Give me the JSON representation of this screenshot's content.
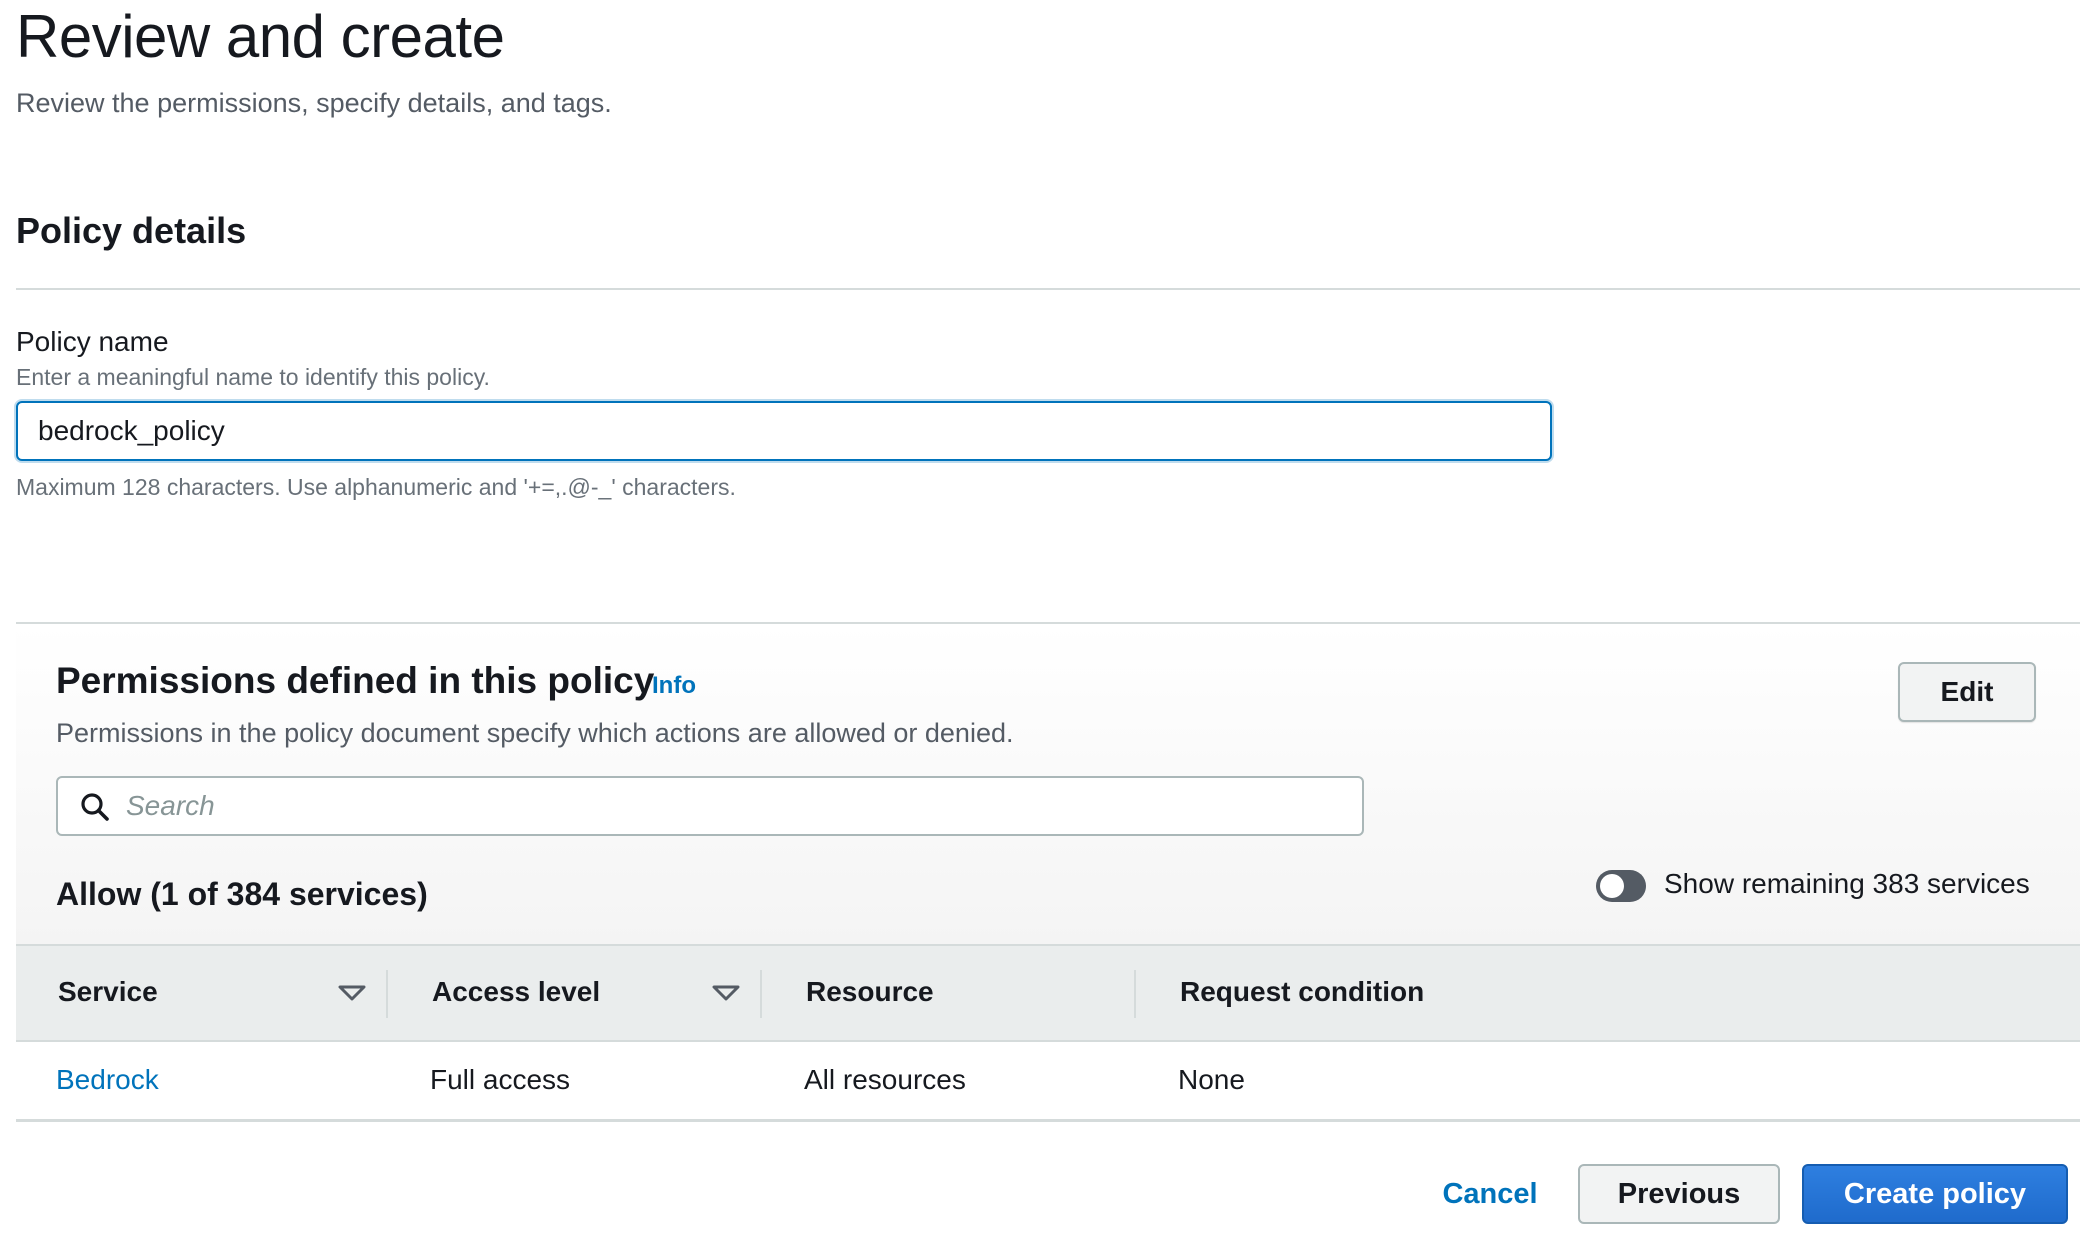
{
  "page": {
    "title": "Review and create",
    "subtitle": "Review the permissions, specify details, and tags."
  },
  "policy_details": {
    "section_title": "Policy details",
    "name_label": "Policy name",
    "name_description": "Enter a meaningful name to identify this policy.",
    "name_value": "bedrock_policy",
    "name_constraint": "Maximum 128 characters. Use alphanumeric and '+=,.@-_' characters."
  },
  "permissions": {
    "title": "Permissions defined in this policy",
    "info_link": "Info",
    "description": "Permissions in the policy document specify which actions are allowed or denied.",
    "edit_label": "Edit",
    "search_placeholder": "Search",
    "allow_title": "Allow (1 of 384 services)",
    "toggle_label": "Show remaining 383 services",
    "toggle_on": false,
    "columns": [
      "Service",
      "Access level",
      "Resource",
      "Request condition"
    ],
    "rows": [
      {
        "service": "Bedrock",
        "access_level": "Full access",
        "resource": "All resources",
        "request_condition": "None"
      }
    ]
  },
  "footer": {
    "cancel_label": "Cancel",
    "previous_label": "Previous",
    "create_label": "Create policy"
  },
  "colors": {
    "link": "#0073bb",
    "primary_button": "#1f6bcc",
    "focus_border": "#0073bb"
  },
  "icons": {
    "search": "search-icon",
    "sort": "caret-down-icon"
  }
}
